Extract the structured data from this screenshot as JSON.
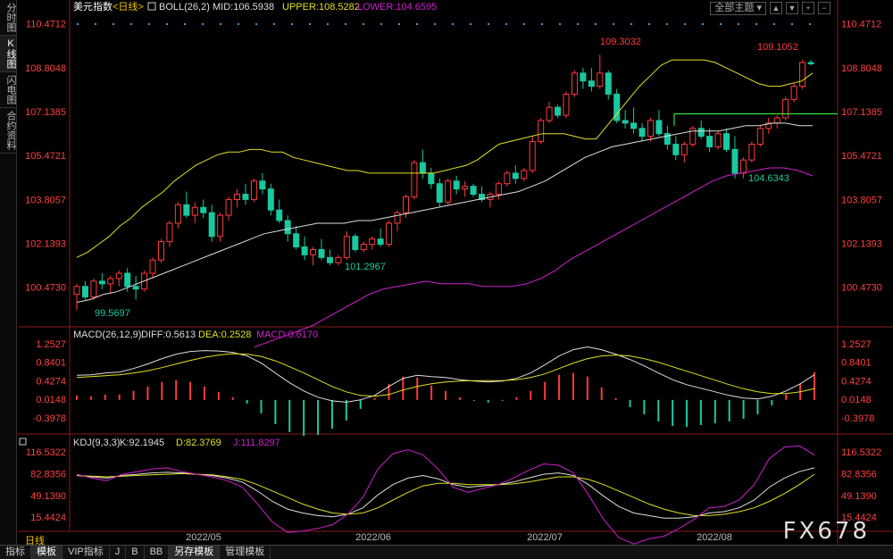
{
  "sidebar": {
    "tabs": [
      {
        "label": "分时图",
        "active": false
      },
      {
        "label": "K线图",
        "active": true
      },
      {
        "label": "闪电图",
        "active": false
      },
      {
        "label": "合约资料",
        "active": false
      }
    ]
  },
  "toolbar": {
    "theme_dropdown": "全部主题",
    "controls": [
      "▲",
      "▼",
      "+",
      "−"
    ]
  },
  "main_header": {
    "name": "美元指数",
    "period": "<日线>",
    "boll_label": "BOLL(26,2)",
    "mid": "MID:106.5938",
    "upper": "UPPER:108.5282",
    "lower": "LOWER:104.6595"
  },
  "macd_header": {
    "label": "MACD(26,12,9)",
    "diff": "DIFF:0.5613",
    "dea": "DEA:0.2528",
    "macd": "MACD:0.6170"
  },
  "kdj_header": {
    "label": "KDJ(9,3,3)",
    "k": "K:92.1945",
    "d": "D:82.3769",
    "j": "J:111.8297"
  },
  "price_axis": [
    "110.4712",
    "108.8048",
    "107.1385",
    "105.4721",
    "103.8057",
    "102.1393",
    "100.4730"
  ],
  "macd_axis": [
    "1.2527",
    "0.8401",
    "0.4274",
    "0.0148",
    "-0.3978"
  ],
  "kdj_axis": [
    "116.5322",
    "82.8356",
    "49.1390",
    "15.4424"
  ],
  "x_axis_labels": [
    "2022/05",
    "2022/06",
    "2022/07",
    "2022/08"
  ],
  "annotations": {
    "high1": "109.3032",
    "high2": "109.1052",
    "low1": "99.5697",
    "low2": "101.2967",
    "low3": "104.6343"
  },
  "bottom_tabs": [
    {
      "label": "指标",
      "active": false
    },
    {
      "label": "模板",
      "active": true
    },
    {
      "label": "VIP指标",
      "active": false
    },
    {
      "label": "J",
      "active": false
    },
    {
      "label": "B",
      "active": false
    },
    {
      "label": "BB",
      "active": false
    },
    {
      "label": "另存模板",
      "active": true
    },
    {
      "label": "管理模板",
      "active": false
    }
  ],
  "period_label": "日线",
  "watermark": "FX678",
  "colors": {
    "up": "#ff3b3b",
    "down": "#19c9a0",
    "mid": "#dddddd",
    "upper": "#e0e020",
    "lower": "#d020d0",
    "axis_text": "#ff4040",
    "header_name": "#ffffff"
  },
  "chart_data": {
    "type": "candlestick",
    "price_ylim": [
      99.0,
      110.9
    ],
    "candles": [
      {
        "o": 100.2,
        "h": 100.6,
        "l": 99.6,
        "c": 100.5
      },
      {
        "o": 100.5,
        "h": 100.7,
        "l": 100.0,
        "c": 100.1
      },
      {
        "o": 100.1,
        "h": 100.8,
        "l": 100.0,
        "c": 100.7
      },
      {
        "o": 100.7,
        "h": 101.0,
        "l": 100.4,
        "c": 100.6
      },
      {
        "o": 100.6,
        "h": 100.9,
        "l": 100.2,
        "c": 100.8
      },
      {
        "o": 100.8,
        "h": 101.1,
        "l": 100.5,
        "c": 101.0
      },
      {
        "o": 101.0,
        "h": 101.2,
        "l": 100.3,
        "c": 100.5
      },
      {
        "o": 100.5,
        "h": 100.9,
        "l": 100.0,
        "c": 100.4
      },
      {
        "o": 100.4,
        "h": 101.1,
        "l": 100.3,
        "c": 101.0
      },
      {
        "o": 101.0,
        "h": 101.6,
        "l": 100.8,
        "c": 101.5
      },
      {
        "o": 101.5,
        "h": 102.3,
        "l": 101.4,
        "c": 102.2
      },
      {
        "o": 102.2,
        "h": 103.0,
        "l": 102.0,
        "c": 102.9
      },
      {
        "o": 102.9,
        "h": 103.7,
        "l": 102.7,
        "c": 103.6
      },
      {
        "o": 103.6,
        "h": 104.1,
        "l": 103.1,
        "c": 103.2
      },
      {
        "o": 103.2,
        "h": 103.7,
        "l": 102.9,
        "c": 103.5
      },
      {
        "o": 103.5,
        "h": 103.8,
        "l": 103.1,
        "c": 103.3
      },
      {
        "o": 103.3,
        "h": 103.6,
        "l": 102.2,
        "c": 102.4
      },
      {
        "o": 102.4,
        "h": 103.3,
        "l": 102.2,
        "c": 103.2
      },
      {
        "o": 103.2,
        "h": 103.9,
        "l": 103.0,
        "c": 103.8
      },
      {
        "o": 103.8,
        "h": 104.2,
        "l": 103.5,
        "c": 104.0
      },
      {
        "o": 104.0,
        "h": 104.4,
        "l": 103.6,
        "c": 103.8
      },
      {
        "o": 103.8,
        "h": 104.6,
        "l": 103.7,
        "c": 104.5
      },
      {
        "o": 104.5,
        "h": 104.8,
        "l": 104.0,
        "c": 104.2
      },
      {
        "o": 104.2,
        "h": 104.4,
        "l": 103.2,
        "c": 103.4
      },
      {
        "o": 103.4,
        "h": 103.8,
        "l": 102.9,
        "c": 103.0
      },
      {
        "o": 103.0,
        "h": 103.2,
        "l": 102.2,
        "c": 102.5
      },
      {
        "o": 102.5,
        "h": 102.8,
        "l": 101.9,
        "c": 102.0
      },
      {
        "o": 102.0,
        "h": 102.4,
        "l": 101.5,
        "c": 101.7
      },
      {
        "o": 101.7,
        "h": 102.0,
        "l": 101.3,
        "c": 101.9
      },
      {
        "o": 101.9,
        "h": 102.3,
        "l": 101.5,
        "c": 101.6
      },
      {
        "o": 101.6,
        "h": 101.9,
        "l": 101.3,
        "c": 101.4
      },
      {
        "o": 101.4,
        "h": 101.7,
        "l": 101.3,
        "c": 101.6
      },
      {
        "o": 101.6,
        "h": 102.6,
        "l": 101.5,
        "c": 102.4
      },
      {
        "o": 102.4,
        "h": 102.5,
        "l": 101.8,
        "c": 101.9
      },
      {
        "o": 101.9,
        "h": 102.2,
        "l": 101.8,
        "c": 102.1
      },
      {
        "o": 102.1,
        "h": 102.4,
        "l": 101.9,
        "c": 102.3
      },
      {
        "o": 102.3,
        "h": 102.7,
        "l": 102.0,
        "c": 102.1
      },
      {
        "o": 102.1,
        "h": 103.0,
        "l": 102.0,
        "c": 102.9
      },
      {
        "o": 102.9,
        "h": 103.4,
        "l": 102.6,
        "c": 103.3
      },
      {
        "o": 103.3,
        "h": 104.0,
        "l": 103.1,
        "c": 103.9
      },
      {
        "o": 103.9,
        "h": 105.3,
        "l": 103.8,
        "c": 105.2
      },
      {
        "o": 105.2,
        "h": 105.7,
        "l": 104.6,
        "c": 104.8
      },
      {
        "o": 104.8,
        "h": 105.0,
        "l": 104.2,
        "c": 104.4
      },
      {
        "o": 104.4,
        "h": 104.6,
        "l": 103.5,
        "c": 103.7
      },
      {
        "o": 103.7,
        "h": 104.6,
        "l": 103.6,
        "c": 104.5
      },
      {
        "o": 104.5,
        "h": 104.7,
        "l": 104.0,
        "c": 104.2
      },
      {
        "o": 104.2,
        "h": 104.5,
        "l": 103.9,
        "c": 104.3
      },
      {
        "o": 104.3,
        "h": 104.4,
        "l": 103.9,
        "c": 104.0
      },
      {
        "o": 104.0,
        "h": 104.3,
        "l": 103.7,
        "c": 103.8
      },
      {
        "o": 103.8,
        "h": 104.1,
        "l": 103.5,
        "c": 104.0
      },
      {
        "o": 104.0,
        "h": 104.5,
        "l": 103.8,
        "c": 104.4
      },
      {
        "o": 104.4,
        "h": 104.9,
        "l": 104.3,
        "c": 104.8
      },
      {
        "o": 104.8,
        "h": 105.1,
        "l": 104.4,
        "c": 104.6
      },
      {
        "o": 104.6,
        "h": 105.0,
        "l": 104.5,
        "c": 104.9
      },
      {
        "o": 104.9,
        "h": 106.2,
        "l": 104.8,
        "c": 106.0
      },
      {
        "o": 106.0,
        "h": 106.9,
        "l": 105.9,
        "c": 106.8
      },
      {
        "o": 106.8,
        "h": 107.5,
        "l": 106.7,
        "c": 107.3
      },
      {
        "o": 107.3,
        "h": 107.4,
        "l": 106.9,
        "c": 107.0
      },
      {
        "o": 107.0,
        "h": 107.9,
        "l": 106.9,
        "c": 107.8
      },
      {
        "o": 107.8,
        "h": 108.7,
        "l": 107.7,
        "c": 108.6
      },
      {
        "o": 108.6,
        "h": 108.8,
        "l": 108.0,
        "c": 108.3
      },
      {
        "o": 108.3,
        "h": 108.8,
        "l": 107.9,
        "c": 108.1
      },
      {
        "o": 108.1,
        "h": 109.3,
        "l": 108.0,
        "c": 108.6
      },
      {
        "o": 108.6,
        "h": 108.7,
        "l": 107.6,
        "c": 107.8
      },
      {
        "o": 107.8,
        "h": 108.0,
        "l": 106.7,
        "c": 106.8
      },
      {
        "o": 106.8,
        "h": 107.2,
        "l": 106.5,
        "c": 106.7
      },
      {
        "o": 106.7,
        "h": 107.3,
        "l": 106.3,
        "c": 106.5
      },
      {
        "o": 106.5,
        "h": 106.7,
        "l": 106.0,
        "c": 106.2
      },
      {
        "o": 106.2,
        "h": 106.9,
        "l": 106.0,
        "c": 106.8
      },
      {
        "o": 106.8,
        "h": 107.2,
        "l": 106.2,
        "c": 106.3
      },
      {
        "o": 106.3,
        "h": 106.6,
        "l": 105.7,
        "c": 105.9
      },
      {
        "o": 105.9,
        "h": 106.2,
        "l": 105.3,
        "c": 105.5
      },
      {
        "o": 105.5,
        "h": 106.0,
        "l": 105.2,
        "c": 105.9
      },
      {
        "o": 105.9,
        "h": 106.6,
        "l": 105.8,
        "c": 106.5
      },
      {
        "o": 106.5,
        "h": 106.8,
        "l": 106.1,
        "c": 106.2
      },
      {
        "o": 106.2,
        "h": 106.5,
        "l": 105.6,
        "c": 105.8
      },
      {
        "o": 105.8,
        "h": 106.4,
        "l": 105.7,
        "c": 106.3
      },
      {
        "o": 106.3,
        "h": 106.5,
        "l": 105.6,
        "c": 105.7
      },
      {
        "o": 105.7,
        "h": 106.2,
        "l": 104.6,
        "c": 104.8
      },
      {
        "o": 104.8,
        "h": 105.4,
        "l": 104.6,
        "c": 105.3
      },
      {
        "o": 105.3,
        "h": 106.0,
        "l": 105.2,
        "c": 105.9
      },
      {
        "o": 105.9,
        "h": 106.6,
        "l": 105.8,
        "c": 106.5
      },
      {
        "o": 106.5,
        "h": 106.9,
        "l": 106.3,
        "c": 106.7
      },
      {
        "o": 106.7,
        "h": 107.0,
        "l": 106.5,
        "c": 106.9
      },
      {
        "o": 106.9,
        "h": 107.7,
        "l": 106.8,
        "c": 107.6
      },
      {
        "o": 107.6,
        "h": 108.2,
        "l": 107.5,
        "c": 108.1
      },
      {
        "o": 108.1,
        "h": 109.1,
        "l": 108.0,
        "c": 109.0
      },
      {
        "o": 109.0,
        "h": 109.1,
        "l": 108.9,
        "c": 108.95
      }
    ],
    "boll_upper": [
      101.6,
      101.8,
      102.1,
      102.4,
      102.8,
      103.1,
      103.5,
      103.8,
      104.1,
      104.5,
      104.8,
      105.1,
      105.3,
      105.5,
      105.6,
      105.6,
      105.7,
      105.7,
      105.6,
      105.6,
      105.4,
      105.3,
      105.2,
      105.1,
      105.0,
      104.9,
      104.9,
      104.8,
      104.8,
      104.8,
      104.8,
      104.8,
      104.8,
      104.8,
      104.9,
      105.0,
      105.1,
      105.3,
      105.6,
      105.9,
      106.0,
      106.1,
      106.2,
      106.3,
      106.3,
      106.3,
      106.2,
      106.1,
      106.1,
      106.6,
      107.1,
      107.6,
      108.1,
      108.5,
      108.9,
      109.1,
      109.1,
      109.1,
      109.1,
      109.0,
      108.8,
      108.6,
      108.4,
      108.2,
      108.1,
      108.1,
      108.2,
      108.3,
      108.6
    ],
    "boll_mid": [
      99.9,
      100.0,
      100.2,
      100.3,
      100.5,
      100.7,
      100.9,
      101.1,
      101.3,
      101.5,
      101.7,
      101.9,
      102.1,
      102.3,
      102.5,
      102.6,
      102.7,
      102.8,
      102.9,
      102.9,
      102.9,
      103.0,
      103.0,
      103.1,
      103.2,
      103.3,
      103.4,
      103.5,
      103.6,
      103.7,
      103.8,
      103.9,
      104.0,
      104.1,
      104.3,
      104.5,
      104.8,
      105.1,
      105.4,
      105.6,
      105.8,
      105.9,
      106.0,
      106.1,
      106.2,
      106.3,
      106.4,
      106.4,
      106.4,
      106.5,
      106.6,
      106.6,
      106.7,
      106.7,
      106.6,
      106.6
    ],
    "boll_lower": [
      98.2,
      98.4,
      98.6,
      98.8,
      99.0,
      99.3,
      99.6,
      99.9,
      100.2,
      100.4,
      100.5,
      100.6,
      100.7,
      100.6,
      100.6,
      100.6,
      100.5,
      100.5,
      100.5,
      100.6,
      100.8,
      101.1,
      101.5,
      101.8,
      102.1,
      102.4,
      102.7,
      103.0,
      103.3,
      103.6,
      103.9,
      104.2,
      104.5,
      104.7,
      104.8,
      104.9,
      105.0,
      105.0,
      104.9,
      104.7
    ],
    "macd_ylim": [
      -0.6,
      1.35
    ],
    "diff": [
      0.55,
      0.56,
      0.6,
      0.62,
      0.7,
      0.8,
      0.92,
      1.02,
      1.08,
      1.1,
      1.09,
      1.06,
      0.98,
      0.82,
      0.6,
      0.38,
      0.2,
      0.06,
      -0.02,
      -0.05,
      0.0,
      0.1,
      0.3,
      0.48,
      0.55,
      0.52,
      0.5,
      0.45,
      0.42,
      0.4,
      0.42,
      0.48,
      0.6,
      0.78,
      0.98,
      1.12,
      1.18,
      1.12,
      1.02,
      0.9,
      0.76,
      0.6,
      0.45,
      0.34,
      0.26,
      0.18,
      0.1,
      0.04,
      0.02,
      0.08,
      0.2,
      0.36,
      0.56
    ],
    "dea": [
      0.5,
      0.52,
      0.54,
      0.56,
      0.6,
      0.65,
      0.72,
      0.8,
      0.88,
      0.95,
      1.0,
      1.03,
      1.02,
      0.97,
      0.87,
      0.74,
      0.6,
      0.45,
      0.3,
      0.18,
      0.1,
      0.08,
      0.12,
      0.22,
      0.3,
      0.36,
      0.4,
      0.42,
      0.43,
      0.43,
      0.43,
      0.45,
      0.5,
      0.58,
      0.7,
      0.82,
      0.92,
      0.98,
      1.0,
      0.98,
      0.92,
      0.84,
      0.74,
      0.64,
      0.54,
      0.44,
      0.34,
      0.25,
      0.18,
      0.14,
      0.14,
      0.18,
      0.25
    ],
    "macd_hist": [
      0.1,
      0.08,
      0.12,
      0.12,
      0.2,
      0.3,
      0.4,
      0.44,
      0.4,
      0.3,
      0.18,
      0.06,
      -0.08,
      -0.3,
      -0.54,
      -0.72,
      -0.8,
      -0.78,
      -0.64,
      -0.46,
      -0.2,
      0.04,
      0.36,
      0.52,
      0.5,
      0.32,
      0.2,
      0.06,
      -0.02,
      -0.06,
      -0.02,
      0.06,
      0.2,
      0.4,
      0.56,
      0.6,
      0.52,
      0.28,
      0.04,
      -0.16,
      -0.32,
      -0.48,
      -0.58,
      -0.6,
      -0.56,
      -0.52,
      -0.48,
      -0.42,
      -0.32,
      -0.12,
      0.12,
      0.36,
      0.62
    ],
    "kdj_ylim": [
      -5,
      125
    ],
    "k": [
      80,
      78,
      76,
      80,
      82,
      84,
      85,
      84,
      82,
      80,
      76,
      70,
      56,
      40,
      28,
      22,
      18,
      16,
      20,
      30,
      50,
      66,
      76,
      80,
      75,
      66,
      62,
      64,
      66,
      70,
      76,
      82,
      84,
      80,
      66,
      48,
      32,
      22,
      18,
      14,
      14,
      16,
      22,
      24,
      30,
      42,
      62,
      76,
      86,
      92
    ],
    "d": [
      80,
      79,
      78,
      79,
      80,
      81,
      82,
      83,
      82,
      81,
      78,
      74,
      66,
      56,
      46,
      36,
      28,
      22,
      20,
      22,
      30,
      42,
      54,
      64,
      68,
      68,
      66,
      66,
      66,
      67,
      70,
      74,
      78,
      78,
      74,
      66,
      56,
      46,
      36,
      28,
      22,
      18,
      18,
      20,
      24,
      30,
      40,
      52,
      66,
      82
    ],
    "j": [
      82,
      76,
      72,
      82,
      86,
      90,
      92,
      86,
      82,
      78,
      72,
      62,
      36,
      8,
      -8,
      -6,
      -2,
      4,
      20,
      46,
      90,
      114,
      120,
      112,
      90,
      62,
      54,
      60,
      66,
      76,
      88,
      98,
      96,
      84,
      50,
      12,
      -16,
      -26,
      -18,
      -14,
      -2,
      12,
      30,
      32,
      42,
      66,
      106,
      124,
      126,
      112
    ]
  }
}
